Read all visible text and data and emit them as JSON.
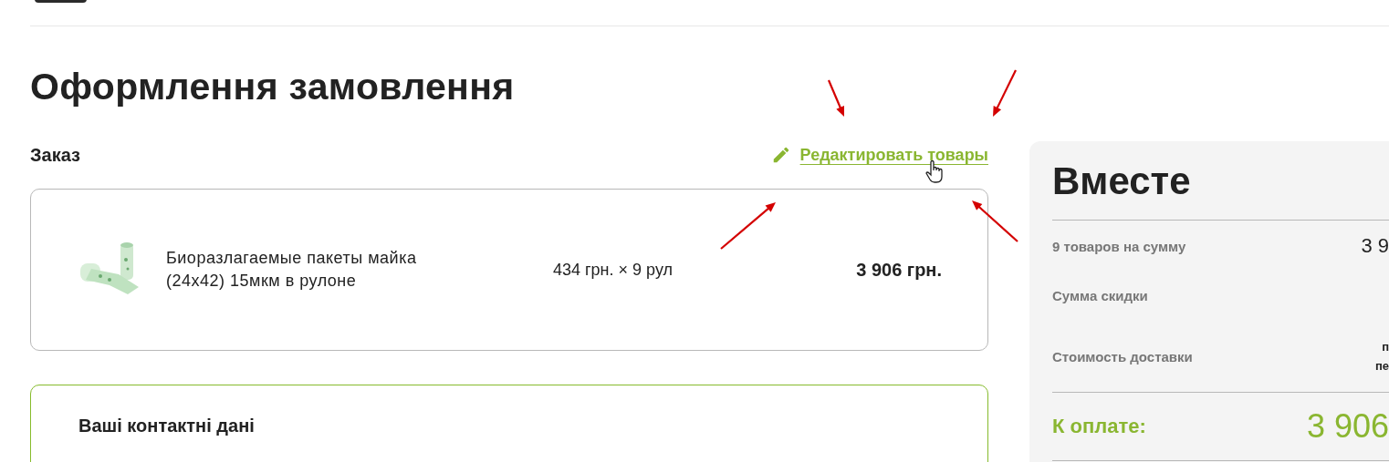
{
  "page_title": "Оформлення замовлення",
  "order": {
    "heading": "Заказ",
    "edit_link": "Редактировать товары",
    "items": [
      {
        "name": "Биоразлагаемые пакеты майка (24x42) 15мкм в рулоне",
        "unit_price": "434 грн. × 9 рул",
        "total": "3 906 грн."
      }
    ]
  },
  "contacts": {
    "heading": "Ваші контактні дані"
  },
  "summary": {
    "title": "Вместе",
    "rows": [
      {
        "label": "9 товаров на сумму",
        "value": [
          "3 9"
        ]
      },
      {
        "label": "Сумма скидки",
        "value": []
      },
      {
        "label": "Стоимость доставки",
        "value": [
          "п",
          "пе"
        ]
      }
    ],
    "total_label": "К оплате:",
    "total_value": "3 906"
  }
}
